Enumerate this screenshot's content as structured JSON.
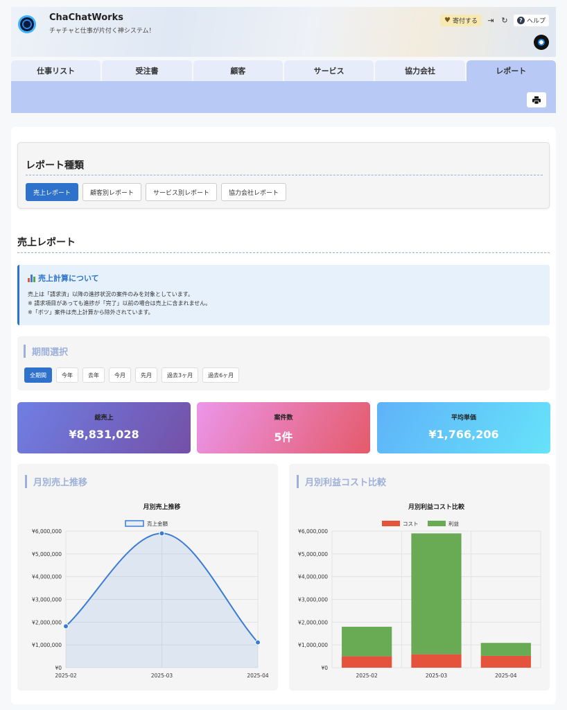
{
  "header": {
    "app_title": "ChaChatWorks",
    "app_subtitle": "チャチャと仕事が片付く神システム！",
    "donate_label": "寄付する",
    "donate_icon": "heart-icon",
    "logout_icon": "logout-icon",
    "refresh_icon": "refresh-icon",
    "help_label": "ヘルプ"
  },
  "tabs": [
    {
      "label": "仕事リスト"
    },
    {
      "label": "受注書"
    },
    {
      "label": "顧客"
    },
    {
      "label": "サービス"
    },
    {
      "label": "協力会社"
    },
    {
      "label": "レポート",
      "active": true
    }
  ],
  "report_types": {
    "heading": "レポート種類",
    "buttons": [
      "売上レポート",
      "顧客別レポート",
      "サービス別レポート",
      "協力会社レポート"
    ],
    "active_index": 0
  },
  "section_title": "売上レポート",
  "info": {
    "title": "売上計算について",
    "lines": [
      "売上は「請求済」以降の進捗状況の案件のみを対象としています。",
      "※ 請求項目があっても進捗が「完了」以前の場合は売上に含まれません。",
      "※「ボツ」案件は売上計算から除外されています。"
    ]
  },
  "period": {
    "heading": "期間選択",
    "buttons": [
      "全期間",
      "今年",
      "去年",
      "今月",
      "先月",
      "過去3ヶ月",
      "過去6ヶ月"
    ],
    "active_index": 0
  },
  "stats": [
    {
      "label": "総売上",
      "value": "¥8,831,028",
      "gradient": [
        "#6f7fe3",
        "#7450a8"
      ]
    },
    {
      "label": "案件数",
      "value": "5件",
      "gradient": [
        "#ec96ea",
        "#e45a6a"
      ]
    },
    {
      "label": "平均単価",
      "value": "¥1,766,206",
      "gradient": [
        "#5fb2f9",
        "#66e3f9"
      ]
    }
  ],
  "charts": {
    "sales_heading": "月別売上推移",
    "profit_heading": "月別利益コスト比較"
  },
  "chart_data": [
    {
      "type": "line",
      "title": "月別売上推移",
      "x": [
        "2025-02",
        "2025-03",
        "2025-04"
      ],
      "series": [
        {
          "name": "売上金額",
          "values": [
            1820000,
            5900000,
            1110000
          ],
          "color": "#3a7bd5"
        }
      ],
      "ylim": [
        0,
        6000000
      ],
      "yticks": [
        "¥0",
        "¥1,000,000",
        "¥2,000,000",
        "¥3,000,000",
        "¥4,000,000",
        "¥5,000,000",
        "¥6,000,000"
      ],
      "legend": "top",
      "grid": true
    },
    {
      "type": "bar",
      "stacked": true,
      "title": "月別利益コスト比較",
      "categories": [
        "2025-02",
        "2025-03",
        "2025-04"
      ],
      "series": [
        {
          "name": "コスト",
          "values": [
            500000,
            590000,
            520000
          ],
          "color": "#e5533d"
        },
        {
          "name": "利益",
          "values": [
            1300000,
            5310000,
            570000
          ],
          "color": "#69aa55"
        }
      ],
      "ylim": [
        0,
        6000000
      ],
      "yticks": [
        "¥0",
        "¥1,000,000",
        "¥2,000,000",
        "¥3,000,000",
        "¥4,000,000",
        "¥5,000,000",
        "¥6,000,000"
      ],
      "legend": "top",
      "grid": true
    }
  ]
}
